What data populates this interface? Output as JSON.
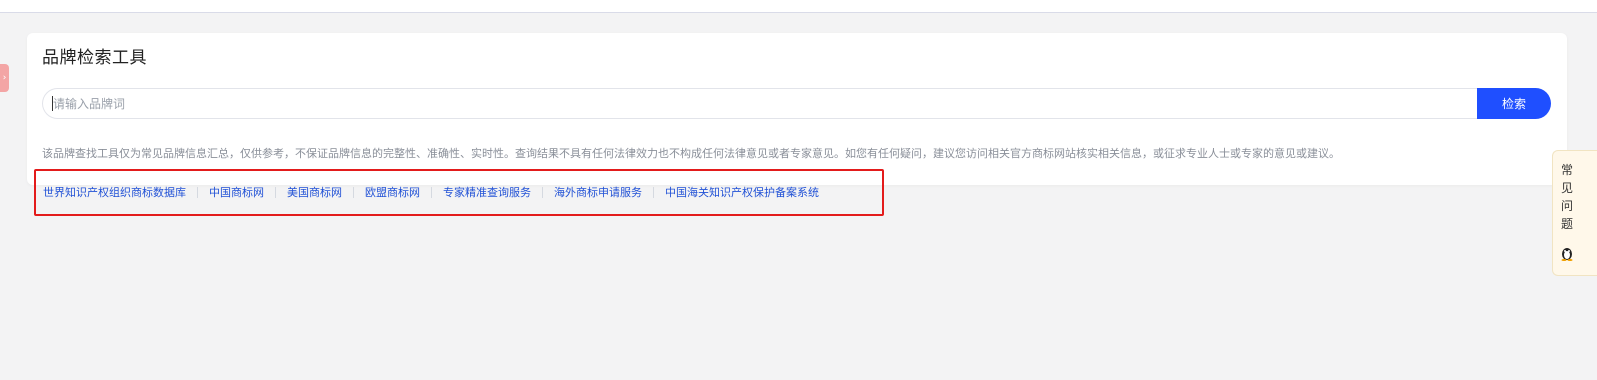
{
  "tool": {
    "title": "品牌检索工具",
    "search": {
      "placeholder": "请输入品牌词",
      "value": "",
      "button_label": "检索"
    },
    "disclaimer": "该品牌查找工具仅为常见品牌信息汇总，仅供参考，不保证品牌信息的完整性、准确性、实时性。查询结果不具有任何法律效力也不构成任何法律意见或者专家意见。如您有任何疑问，建议您访问相关官方商标网站核实相关信息，或征求专业人士或专家的意见或建议。",
    "links": [
      "世界知识产权组织商标数据库",
      "中国商标网",
      "美国商标网",
      "欧盟商标网",
      "专家精准查询服务",
      "海外商标申请服务",
      "中国海关知识产权保护备案系统"
    ]
  },
  "side_panel": {
    "text": "常见问题"
  },
  "colors": {
    "accent": "#1f4fff",
    "link": "#2252d6",
    "highlight_border": "#e31b1b"
  }
}
